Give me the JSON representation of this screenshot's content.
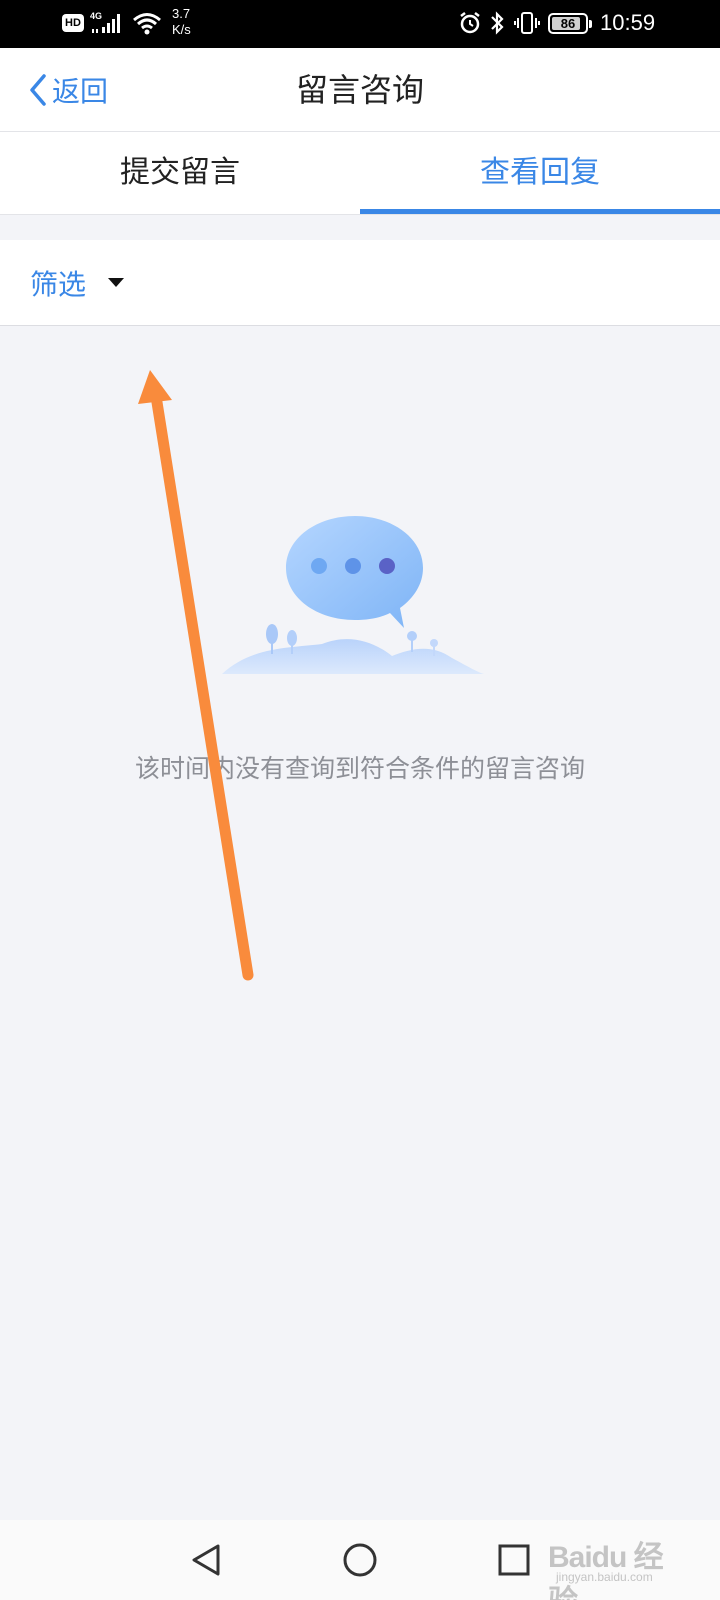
{
  "status_bar": {
    "hd": "HD",
    "network": "4G",
    "speed_value": "3.7",
    "speed_unit": "K/s",
    "battery": "86",
    "time": "10:59"
  },
  "nav": {
    "back_label": "返回",
    "title": "留言咨询"
  },
  "tabs": [
    {
      "label": "提交留言",
      "active": false
    },
    {
      "label": "查看回复",
      "active": true
    }
  ],
  "filter": {
    "label": "筛选"
  },
  "empty_state": {
    "message": "该时间内没有查询到符合条件的留言咨询"
  },
  "watermark": {
    "logo": "Baidu 经验",
    "url": "jingyan.baidu.com"
  },
  "colors": {
    "accent": "#3a87e6",
    "background": "#f3f4f8",
    "annotation_arrow": "#f98b3c"
  },
  "icons": {
    "back": "chevron-left-icon",
    "filter_caret": "caret-down-icon",
    "system_back": "triangle-back-icon",
    "system_home": "circle-home-icon",
    "system_recent": "square-recent-icon"
  }
}
